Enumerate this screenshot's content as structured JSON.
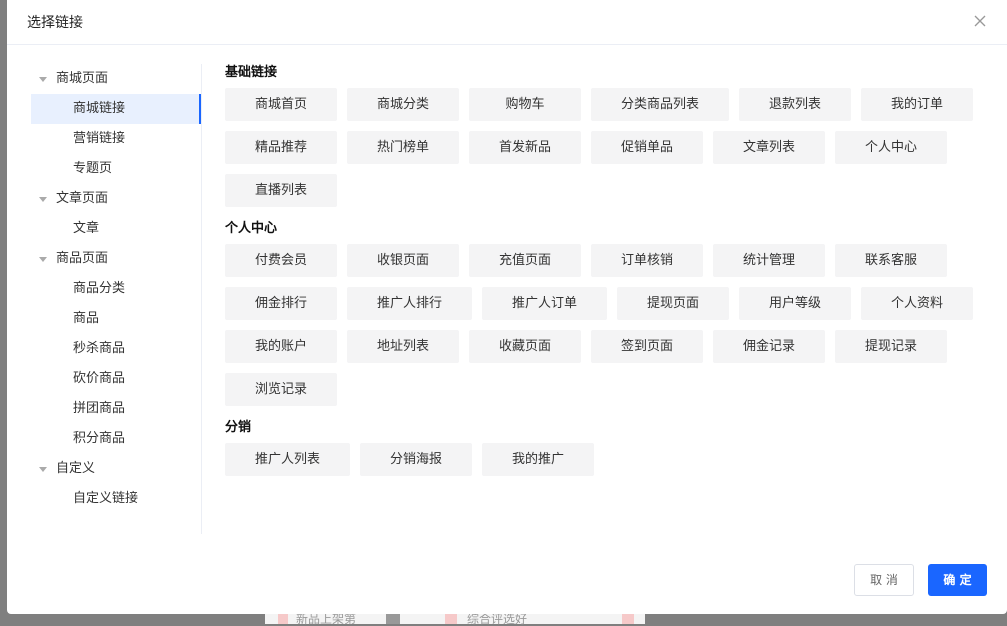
{
  "dialog": {
    "title": "选择链接",
    "cancel_label": "取 消",
    "ok_label": "确 定"
  },
  "tree": [
    {
      "label": "商城页面",
      "level": "parent"
    },
    {
      "label": "商城链接",
      "level": "child",
      "active": true
    },
    {
      "label": "营销链接",
      "level": "child"
    },
    {
      "label": "专题页",
      "level": "child"
    },
    {
      "label": "文章页面",
      "level": "parent"
    },
    {
      "label": "文章",
      "level": "child"
    },
    {
      "label": "商品页面",
      "level": "parent"
    },
    {
      "label": "商品分类",
      "level": "child"
    },
    {
      "label": "商品",
      "level": "child"
    },
    {
      "label": "秒杀商品",
      "level": "child"
    },
    {
      "label": "砍价商品",
      "level": "child"
    },
    {
      "label": "拼团商品",
      "level": "child"
    },
    {
      "label": "积分商品",
      "level": "child"
    },
    {
      "label": "自定义",
      "level": "parent"
    },
    {
      "label": "自定义链接",
      "level": "child"
    }
  ],
  "sections": [
    {
      "title": "基础链接",
      "links": [
        "商城首页",
        "商城分类",
        "购物车",
        "分类商品列表",
        "退款列表",
        "我的订单",
        "精品推荐",
        "热门榜单",
        "首发新品",
        "促销单品",
        "文章列表",
        "个人中心",
        "直播列表"
      ]
    },
    {
      "title": "个人中心",
      "links": [
        "付费会员",
        "收银页面",
        "充值页面",
        "订单核销",
        "统计管理",
        "联系客服",
        "佣金排行",
        "推广人排行",
        "推广人订单",
        "提现页面",
        "用户等级",
        "个人资料",
        "我的账户",
        "地址列表",
        "收藏页面",
        "签到页面",
        "佣金记录",
        "提现记录",
        "浏览记录"
      ]
    },
    {
      "title": "分销",
      "links": [
        "推广人列表",
        "分销海报",
        "我的推广"
      ]
    }
  ],
  "background_peek": {
    "text1": "新品上架第",
    "text2": "综合评选好"
  },
  "colors": {
    "accent": "#1a66ff",
    "button_bg": "#f4f4f5",
    "active_bg": "#e8f0fe"
  }
}
